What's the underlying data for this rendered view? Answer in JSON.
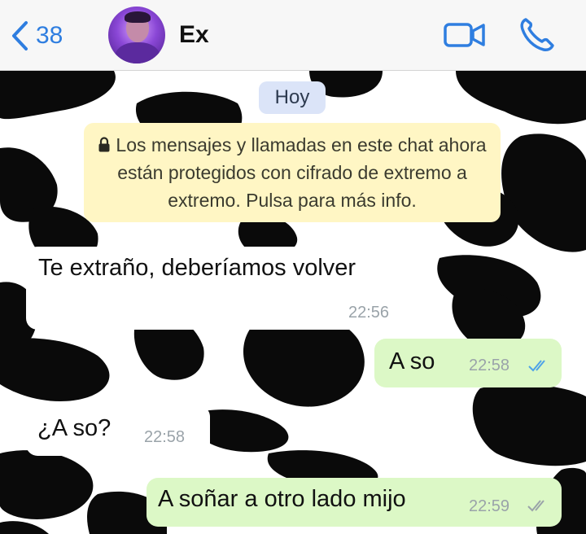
{
  "header": {
    "back_count": "38",
    "contact_name": "Ex"
  },
  "chat": {
    "date_label": "Hoy",
    "encryption_notice": "Los mensajes y llamadas en este chat ahora están protegidos con cifrado de extremo a extremo. Pulsa para más info.",
    "messages": [
      {
        "direction": "incoming",
        "text": "Te extraño, deberíamos volver",
        "time": "22:56"
      },
      {
        "direction": "outgoing",
        "text": "A so",
        "time": "22:58",
        "status": "read"
      },
      {
        "direction": "incoming",
        "text": "¿A so?",
        "time": "22:58"
      },
      {
        "direction": "outgoing",
        "text": "A soñar a otro lado mijo",
        "time": "22:59",
        "status": "delivered"
      }
    ]
  },
  "colors": {
    "accent_blue": "#2f7ee0",
    "outgoing_bubble": "#dcf8c6",
    "incoming_bubble": "#ffffff",
    "encryption_bg": "#fff6c4",
    "date_pill_bg": "#dbe4f8",
    "read_ticks": "#4fa3e8",
    "delivered_ticks": "#9aa3a9"
  },
  "icons": {
    "back": "chevron-left-icon",
    "video": "video-camera-icon",
    "phone": "phone-icon",
    "lock": "lock-icon",
    "read_receipt": "double-check-icon"
  }
}
